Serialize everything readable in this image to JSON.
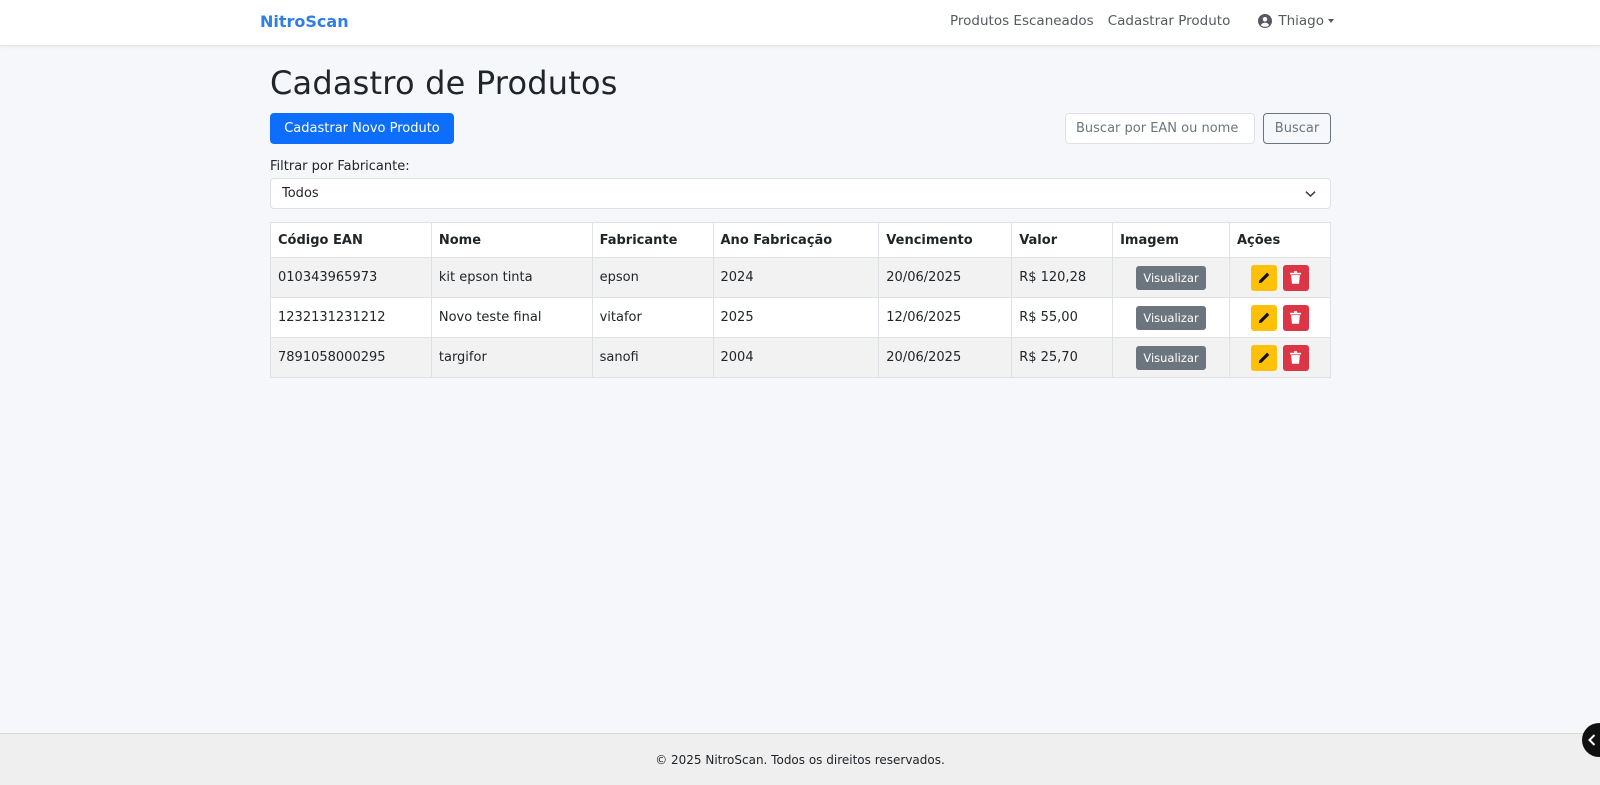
{
  "navbar": {
    "brand": "NitroScan",
    "links": [
      "Produtos Escaneados",
      "Cadastrar Produto"
    ],
    "user": "Thiago"
  },
  "page": {
    "title": "Cadastro de Produtos",
    "new_product_button": "Cadastrar Novo Produto",
    "search_placeholder": "Buscar por EAN ou nome",
    "search_button": "Buscar",
    "filter_label": "Filtrar por Fabricante:",
    "filter_selected": "Todos"
  },
  "table": {
    "headers": [
      "Código EAN",
      "Nome",
      "Fabricante",
      "Ano Fabricação",
      "Vencimento",
      "Valor",
      "Imagem",
      "Ações"
    ],
    "rows": [
      {
        "ean": "010343965973",
        "nome": "kit epson tinta",
        "fabricante": "epson",
        "ano": "2024",
        "vencimento": "20/06/2025",
        "valor": "R$ 120,28",
        "imagem": "Visualizar"
      },
      {
        "ean": "1232131231212",
        "nome": "Novo teste final",
        "fabricante": "vitafor",
        "ano": "2025",
        "vencimento": "12/06/2025",
        "valor": "R$ 55,00",
        "imagem": "Visualizar"
      },
      {
        "ean": "7891058000295",
        "nome": "targifor",
        "fabricante": "sanofi",
        "ano": "2004",
        "vencimento": "20/06/2025",
        "valor": "R$ 25,70",
        "imagem": "Visualizar"
      }
    ]
  },
  "footer": {
    "text": "© 2025 NitroScan. Todos os direitos reservados."
  },
  "icons": {
    "user": "user-circle-icon",
    "dropdown": "chevron-down-icon",
    "edit": "pencil-icon",
    "delete": "trash-icon"
  },
  "colors": {
    "brand": "#2f7ee6",
    "primary": "#0d6efd",
    "secondary": "#6c757d",
    "warning": "#ffc107",
    "danger": "#dc3545"
  }
}
